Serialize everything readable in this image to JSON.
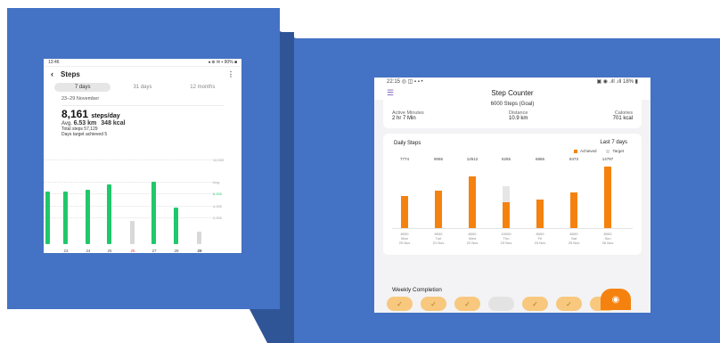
{
  "left_phone": {
    "status_time": "13:46",
    "status_icons": "◂ ⊕ ✉ ▪ 90% ■",
    "title": "Steps",
    "tabs": [
      "7 days",
      "31 days",
      "12 months"
    ],
    "date_range": "23–29 November",
    "steps_value": "8,161",
    "steps_unit": "steps/day",
    "avg_label": "Avg.",
    "avg_km": "6.53 km",
    "avg_kcal": "348 kcal",
    "total_steps": "Total steps   57,129",
    "days_target": "Days target achieved   5",
    "y_labels": [
      "10,000",
      "Avg.",
      "6,000",
      "4,000",
      "2,000"
    ],
    "x_labels": [
      "23",
      "24",
      "25",
      "26",
      "27",
      "28",
      "29"
    ],
    "bar_levels": [
      0.76,
      0.75,
      0.78,
      0.86,
      0.33,
      0.9,
      0.52,
      0.18
    ],
    "bar_colors": [
      "#1fc86a",
      "#1fc86a",
      "#1fc86a",
      "#1fc86a",
      "#d8d8d8",
      "#1fc86a",
      "#1fc86a",
      "#d8d8d8"
    ],
    "accent": "#1fc86a"
  },
  "right_phone": {
    "status_time": "22:15",
    "status_icons": "◎ ◫ ▪ ▪ •",
    "status_right": "▣ ◉ .ıll .ıll 18% ▮",
    "app_title": "Step Counter",
    "goal_text": "6000 Steps (Goal)",
    "metrics": [
      {
        "label": "Active Minutes",
        "value": "2 hr 7 Min"
      },
      {
        "label": "Distance",
        "value": "10.9 km"
      },
      {
        "label": "Calories",
        "value": "701 kcal"
      }
    ],
    "chart_title": "Daily Steps",
    "chart_range": "Last 7 days",
    "legend_achieved": "Achieved",
    "legend_target": "Target",
    "accent": "#f5820f",
    "weekly_title": "Weekly Completion",
    "weekly_states": [
      true,
      true,
      true,
      false,
      true,
      true,
      true
    ]
  },
  "chart_data": {
    "type": "bar",
    "title": "Daily Steps",
    "categories": [
      "Mon 20 Nov",
      "Tue 21 Nov",
      "Wed 22 Nov",
      "Thu 23 Nov",
      "Fri 24 Nov",
      "Sat 25 Nov",
      "Sun 26 Nov"
    ],
    "category_lines": [
      [
        "8000",
        "Mon",
        "20 Nov"
      ],
      [
        "8000",
        "Tue",
        "21 Nov"
      ],
      [
        "8000",
        "Wed",
        "22 Nov"
      ],
      [
        "10000",
        "Thu",
        "23 Nov"
      ],
      [
        "8000",
        "Fri",
        "24 Nov"
      ],
      [
        "8000",
        "Sat",
        "25 Nov"
      ],
      [
        "8000",
        "Sun",
        "26 Nov"
      ]
    ],
    "series": [
      {
        "name": "Achieved",
        "values": [
          7774,
          9065,
          12512,
          6255,
          6866,
          8473,
          14797
        ]
      },
      {
        "name": "Target",
        "values": [
          8000,
          8000,
          8000,
          10000,
          8000,
          8000,
          8000
        ]
      }
    ],
    "value_labels": [
      "7774",
      "9065",
      "12512",
      "6255",
      "6866",
      "8473",
      "14797"
    ],
    "ylim": [
      0,
      15000
    ]
  }
}
